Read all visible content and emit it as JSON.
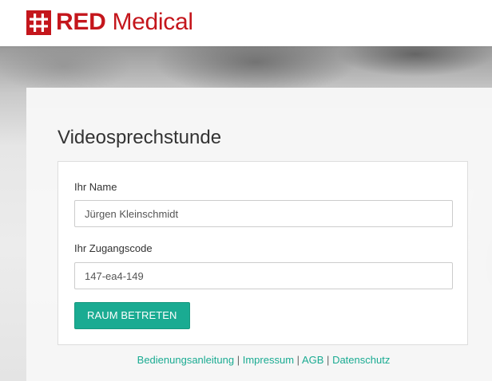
{
  "header": {
    "logo_bold": "RED",
    "logo_light": "Medical",
    "brand_color": "#c4161c"
  },
  "main": {
    "title": "Videosprechstunde",
    "form": {
      "name_label": "Ihr Name",
      "name_value": "Jürgen Kleinschmidt",
      "code_label": "Ihr Zugangscode",
      "code_value": "147-ea4-149",
      "submit_label": "RAUM BETRETEN"
    },
    "accent_color": "#1aab92"
  },
  "footer": {
    "links": [
      "Bedienungsanleitung",
      "Impressum",
      "AGB",
      "Datenschutz"
    ],
    "separator": "|"
  },
  "icons": {
    "logo": "hash-grid-logo-icon"
  }
}
